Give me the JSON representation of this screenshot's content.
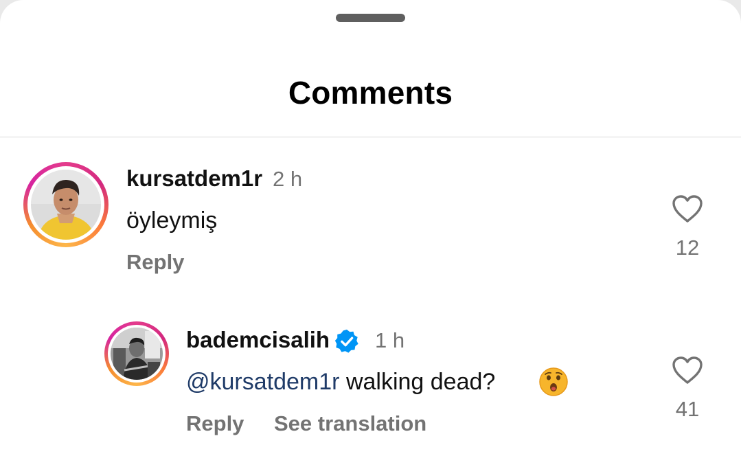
{
  "header": {
    "title": "Comments"
  },
  "comments": [
    {
      "username": "kursatdem1r",
      "time": "2 h",
      "text": "öyleymiş",
      "reply_label": "Reply",
      "likes": "12"
    },
    {
      "username": "bademcisalih",
      "verified": true,
      "time": "1 h",
      "mention": "@kursatdem1r",
      "text": "walking dead?",
      "emoji": "astonished-face",
      "reply_label": "Reply",
      "translate_label": "See translation",
      "likes": "41"
    }
  ],
  "colors": {
    "mention": "#1f3b68",
    "verified": "#0095f6",
    "secondary_text": "#737373"
  }
}
